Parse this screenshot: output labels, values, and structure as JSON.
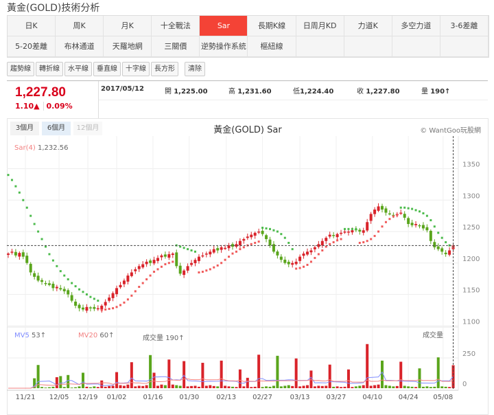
{
  "page_title": "黃金(GOLD)技術分析",
  "tabs": [
    {
      "label": "日K"
    },
    {
      "label": "周K"
    },
    {
      "label": "月K"
    },
    {
      "label": "十全戰法"
    },
    {
      "label": "Sar",
      "active": true
    },
    {
      "label": "長期K線"
    },
    {
      "label": "日周月KD"
    },
    {
      "label": "力道K"
    },
    {
      "label": "多空力道"
    },
    {
      "label": "3-6差離"
    },
    {
      "label": "5-20差離"
    },
    {
      "label": "布林通道"
    },
    {
      "label": "天羅地網"
    },
    {
      "label": "三關價"
    },
    {
      "label": "逆勢操作系統"
    },
    {
      "label": "樞紐線"
    }
  ],
  "tools": [
    "趨勢線",
    "轉折線",
    "水平線",
    "垂直線",
    "十字線",
    "長方形",
    "清除"
  ],
  "quote": {
    "price": "1,227.80",
    "change": "1.10▲",
    "change_pct": "0.09%",
    "date": "2017/05/12",
    "open_label": "開",
    "open": "1,225.00",
    "high_label": "高",
    "high": "1,231.60",
    "low_label": "低",
    "low": "1,224.40",
    "close_label": "收",
    "close": "1,227.80",
    "vol_label": "量",
    "vol": "190↑"
  },
  "periods": [
    {
      "label": "3個月"
    },
    {
      "label": "6個月",
      "selected": true
    },
    {
      "label": "12個月",
      "disabled": true
    }
  ],
  "chart_title": "黃金(GOLD) Sar",
  "copyright": "© WantGoo玩股網",
  "colors": {
    "up": "#d9232a",
    "down": "#5aa51c",
    "sar_up": "#f05a5a",
    "sar_down": "#4cbb4c",
    "mv5": "#7f8cff",
    "mv20": "#f28080",
    "accent": "#f44336"
  },
  "chart_data": {
    "type": "candlestick",
    "sar_label": "Sar(4)",
    "sar_value": "1,232.56",
    "mv5_label": "MV5",
    "mv5_value": "53↑",
    "mv20_label": "MV20",
    "mv20_value": "60↑",
    "volume_label": "成交量",
    "volume_value": "190↑",
    "volume_axis_title": "成交量",
    "price_ticks": [
      1100,
      1150,
      1200,
      1250,
      1300,
      1350
    ],
    "volume_ticks": [
      0,
      250
    ],
    "ylim": [
      1100,
      1380
    ],
    "x_ticks": [
      "11/21",
      "12/05",
      "12/19",
      "01/02",
      "01/16",
      "01/30",
      "02/13",
      "02/27",
      "03/13",
      "03/27",
      "04/10",
      "04/24",
      "05/08"
    ],
    "last_close": 1227.8,
    "close": [
      1215,
      1218,
      1212,
      1216,
      1210,
      1200,
      1185,
      1178,
      1172,
      1170,
      1168,
      1165,
      1160,
      1162,
      1158,
      1155,
      1150,
      1140,
      1132,
      1128,
      1126,
      1130,
      1128,
      1127,
      1128,
      1132,
      1138,
      1145,
      1152,
      1160,
      1165,
      1172,
      1180,
      1185,
      1190,
      1195,
      1198,
      1202,
      1200,
      1205,
      1208,
      1212,
      1210,
      1214,
      1215,
      1195,
      1183,
      1188,
      1195,
      1200,
      1205,
      1210,
      1212,
      1215,
      1218,
      1222,
      1220,
      1225,
      1224,
      1228,
      1226,
      1230,
      1235,
      1238,
      1242,
      1245,
      1248,
      1250,
      1246,
      1238,
      1228,
      1218,
      1212,
      1205,
      1200,
      1198,
      1200,
      1202,
      1210,
      1215,
      1218,
      1220,
      1225,
      1230,
      1235,
      1240,
      1245,
      1243,
      1246,
      1248,
      1250,
      1250,
      1252,
      1252,
      1250,
      1252,
      1265,
      1278,
      1285,
      1290,
      1285,
      1280,
      1278,
      1276,
      1278,
      1280,
      1272,
      1262,
      1260,
      1262,
      1260,
      1255,
      1252,
      1235,
      1225,
      1222,
      1218,
      1214,
      1220,
      1227.8
    ],
    "sar": [
      1340,
      1332,
      1322,
      1312,
      1300,
      1288,
      1275,
      1262,
      1250,
      1238,
      1226,
      1214,
      1204,
      1195,
      1187,
      1180,
      1174,
      1168,
      1163,
      1158,
      1154,
      1150,
      1146,
      1143,
      1140,
      1125,
      1126,
      1127,
      1128,
      1130,
      1133,
      1137,
      1142,
      1148,
      1155,
      1162,
      1168,
      1174,
      1180,
      1186,
      1190,
      1194,
      1198,
      1200,
      1202,
      1228,
      1226,
      1224,
      1222,
      1220,
      1218,
      1185,
      1186,
      1188,
      1190,
      1193,
      1196,
      1200,
      1205,
      1210,
      1215,
      1218,
      1222,
      1225,
      1228,
      1230,
      1232,
      1234,
      1256,
      1255,
      1254,
      1252,
      1250,
      1246,
      1240,
      1232,
      1222,
      1191,
      1192,
      1194,
      1197,
      1202,
      1208,
      1214,
      1220,
      1226,
      1230,
      1233,
      1236,
      1238,
      1254,
      1254,
      1254,
      1254,
      1232,
      1233,
      1235,
      1238,
      1243,
      1250,
      1258,
      1265,
      1270,
      1274,
      1276,
      1288,
      1288,
      1287,
      1286,
      1284,
      1282,
      1279,
      1275,
      1268,
      1258,
      1248,
      1240,
      1233,
      1228,
      1225
    ],
    "volume": [
      0,
      0,
      0,
      0,
      0,
      0,
      0,
      82,
      192,
      10,
      5,
      8,
      12,
      91,
      100,
      10,
      109,
      5,
      8,
      15,
      128,
      12,
      8,
      15,
      10,
      64,
      12,
      18,
      20,
      133,
      25,
      20,
      30,
      215,
      15,
      20,
      18,
      25,
      274,
      128,
      20,
      30,
      25,
      237,
      30,
      25,
      20,
      224,
      15,
      18,
      20,
      12,
      210,
      20,
      25,
      18,
      15,
      228,
      20,
      15,
      12,
      10,
      155,
      15,
      86,
      10,
      12,
      277,
      10,
      15,
      12,
      20,
      268,
      15,
      20,
      25,
      18,
      246,
      15,
      20,
      25,
      146,
      15,
      20,
      18,
      20,
      195,
      12,
      15,
      10,
      12,
      155,
      10,
      15,
      20,
      25,
      365,
      20,
      25,
      30,
      228,
      25,
      20,
      15,
      18,
      219,
      20,
      15,
      12,
      10,
      164,
      12,
      15,
      10,
      12,
      255,
      15,
      12,
      10,
      190
    ]
  }
}
